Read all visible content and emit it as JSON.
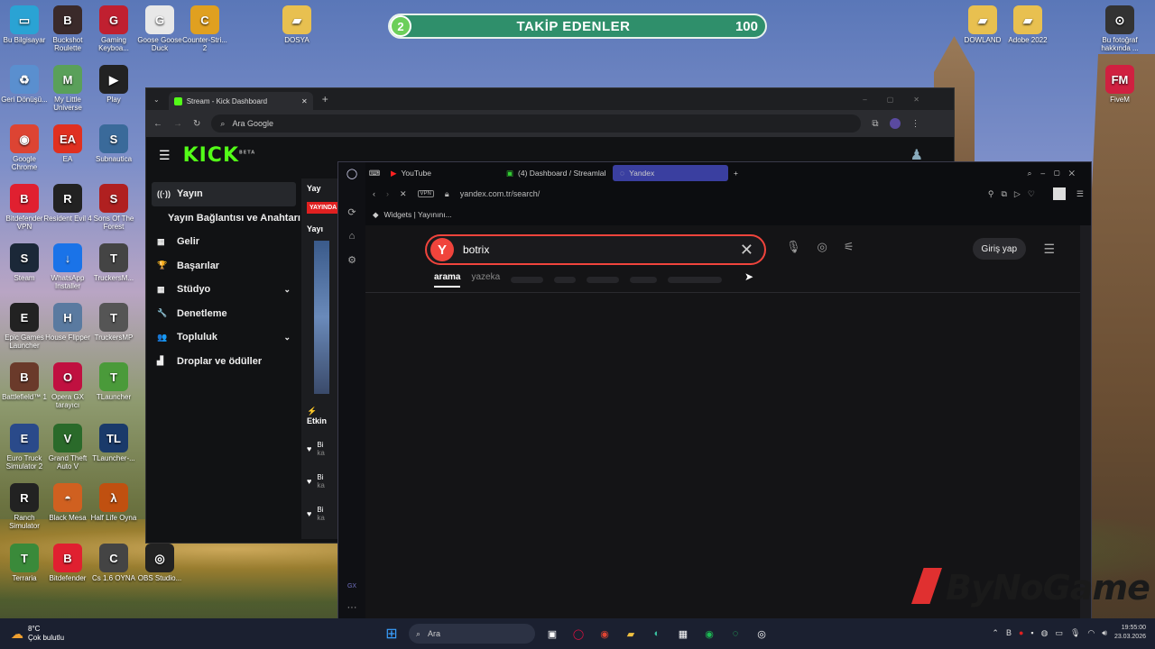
{
  "banner": {
    "level": "2",
    "title": "TAKİP EDENLER",
    "count": "100"
  },
  "desktop_icons": [
    {
      "label": "Bu Bilgisayar",
      "color": "#2aa3d4",
      "glyph": "▭"
    },
    {
      "label": "Buckshot Roulette",
      "color": "#3a2a2a",
      "glyph": "B"
    },
    {
      "label": "Gaming Keyboa...",
      "color": "#c02030",
      "glyph": "G"
    },
    {
      "label": "Goose Goose Duck",
      "color": "#e8e8e8",
      "glyph": "G"
    },
    {
      "label": "Counter-Stri... 2",
      "color": "#e0a020",
      "glyph": "C"
    },
    {
      "label": "DOSYA",
      "color": "#e8c050",
      "glyph": "▰"
    },
    {
      "label": "Geri Dönüşü...",
      "color": "#5a8fcf",
      "glyph": "♻"
    },
    {
      "label": "My Little Universe",
      "color": "#5aa05a",
      "glyph": "M"
    },
    {
      "label": "Play",
      "color": "#222",
      "glyph": "▶"
    },
    {
      "label": "Google Chrome",
      "color": "#dd4433",
      "glyph": "◉"
    },
    {
      "label": "EA",
      "color": "#e03020",
      "glyph": "EA"
    },
    {
      "label": "Subnautica",
      "color": "#3a6a9a",
      "glyph": "S"
    },
    {
      "label": "Bitdefender VPN",
      "color": "#e02030",
      "glyph": "B"
    },
    {
      "label": "Resident Evil 4",
      "color": "#222",
      "glyph": "R"
    },
    {
      "label": "Sons Of The Forest",
      "color": "#b02020",
      "glyph": "S"
    },
    {
      "label": "Steam",
      "color": "#1b2838",
      "glyph": "S"
    },
    {
      "label": "WhatsApp Installer",
      "color": "#1a73e8",
      "glyph": "↓"
    },
    {
      "label": "TruckersM...",
      "color": "#444",
      "glyph": "T"
    },
    {
      "label": "Epic Games Launcher",
      "color": "#222",
      "glyph": "E"
    },
    {
      "label": "House Flipper",
      "color": "#5a7aa0",
      "glyph": "H"
    },
    {
      "label": "TruckersMP",
      "color": "#555",
      "glyph": "T"
    },
    {
      "label": "Battlefield™ 1",
      "color": "#6a3a2a",
      "glyph": "B"
    },
    {
      "label": "Opera GX tarayıcı",
      "color": "#c01040",
      "glyph": "O"
    },
    {
      "label": "TLauncher",
      "color": "#4a9a3a",
      "glyph": "T"
    },
    {
      "label": "Euro Truck Simulator 2",
      "color": "#2a4a8a",
      "glyph": "E"
    },
    {
      "label": "Grand Theft Auto V",
      "color": "#2a6a2a",
      "glyph": "V"
    },
    {
      "label": "TLauncher-...",
      "color": "#1a3a6a",
      "glyph": "TL"
    },
    {
      "label": "Ranch Simulator",
      "color": "#222",
      "glyph": "R"
    },
    {
      "label": "Black Mesa",
      "color": "#d06020",
      "glyph": "◓"
    },
    {
      "label": "Half Life Oyna",
      "color": "#c05010",
      "glyph": "λ"
    },
    {
      "label": "Terraria",
      "color": "#3a8a3a",
      "glyph": "T"
    },
    {
      "label": "Bitdefender",
      "color": "#e02030",
      "glyph": "B"
    },
    {
      "label": "Cs 1.6 OYNA",
      "color": "#444",
      "glyph": "C"
    },
    {
      "label": "OBS Studio...",
      "color": "#222",
      "glyph": "◎"
    },
    {
      "label": "DOWLAND",
      "color": "#e8c050",
      "glyph": "▰"
    },
    {
      "label": "Adobe 2022",
      "color": "#e8c050",
      "glyph": "▰"
    },
    {
      "label": "Bu fotoğraf hakkında ...",
      "color": "#333",
      "glyph": "⊙"
    },
    {
      "label": "FiveM",
      "color": "#d02040",
      "glyph": "FM"
    }
  ],
  "chrome": {
    "tab_title": "Stream - Kick Dashboard",
    "address": "Ara Google",
    "kick_logo": "KICK",
    "kick_beta": "BETA",
    "sidebar": [
      {
        "label": "Yayın",
        "icon": "((·))",
        "chev": ""
      },
      {
        "label": "Yayın Bağlantısı ve Anahtarı",
        "icon": "",
        "chev": ""
      },
      {
        "label": "Gelir",
        "icon": "▦",
        "chev": ""
      },
      {
        "label": "Başarılar",
        "icon": "🏆",
        "chev": ""
      },
      {
        "label": "Stüdyo",
        "icon": "▦",
        "chev": "⌄"
      },
      {
        "label": "Denetleme",
        "icon": "🔧",
        "chev": ""
      },
      {
        "label": "Topluluk",
        "icon": "👥",
        "chev": "⌄"
      },
      {
        "label": "Droplar ve ödüller",
        "icon": "▟",
        "chev": ""
      }
    ],
    "right": {
      "yay1": "Yay",
      "badge": "YAYINDA",
      "yay2": "Yayı",
      "etkin": "Etkin",
      "rows": [
        {
          "a": "Bi",
          "b": "ka"
        },
        {
          "a": "Bi",
          "b": "ka"
        },
        {
          "a": "Bi",
          "b": "ka"
        }
      ]
    }
  },
  "opera": {
    "tabs": [
      "YouTube",
      "(4) Dashboard / Streamlab",
      "Yandex"
    ],
    "url": "yandex.com.tr/search/",
    "vpn": "VPN",
    "bookmark": "Widgets | Yayınını...",
    "gx": "GX",
    "search": {
      "logo": "Y",
      "query": "botrix",
      "login": "Giriş yap",
      "tabs": [
        "arama",
        "yazeka"
      ]
    }
  },
  "taskbar": {
    "temp": "8°C",
    "weather": "Çok bulutlu",
    "search": "Ara",
    "time": "19:55:00",
    "date": "23.03.2026"
  },
  "watermark": "ByNoGame"
}
